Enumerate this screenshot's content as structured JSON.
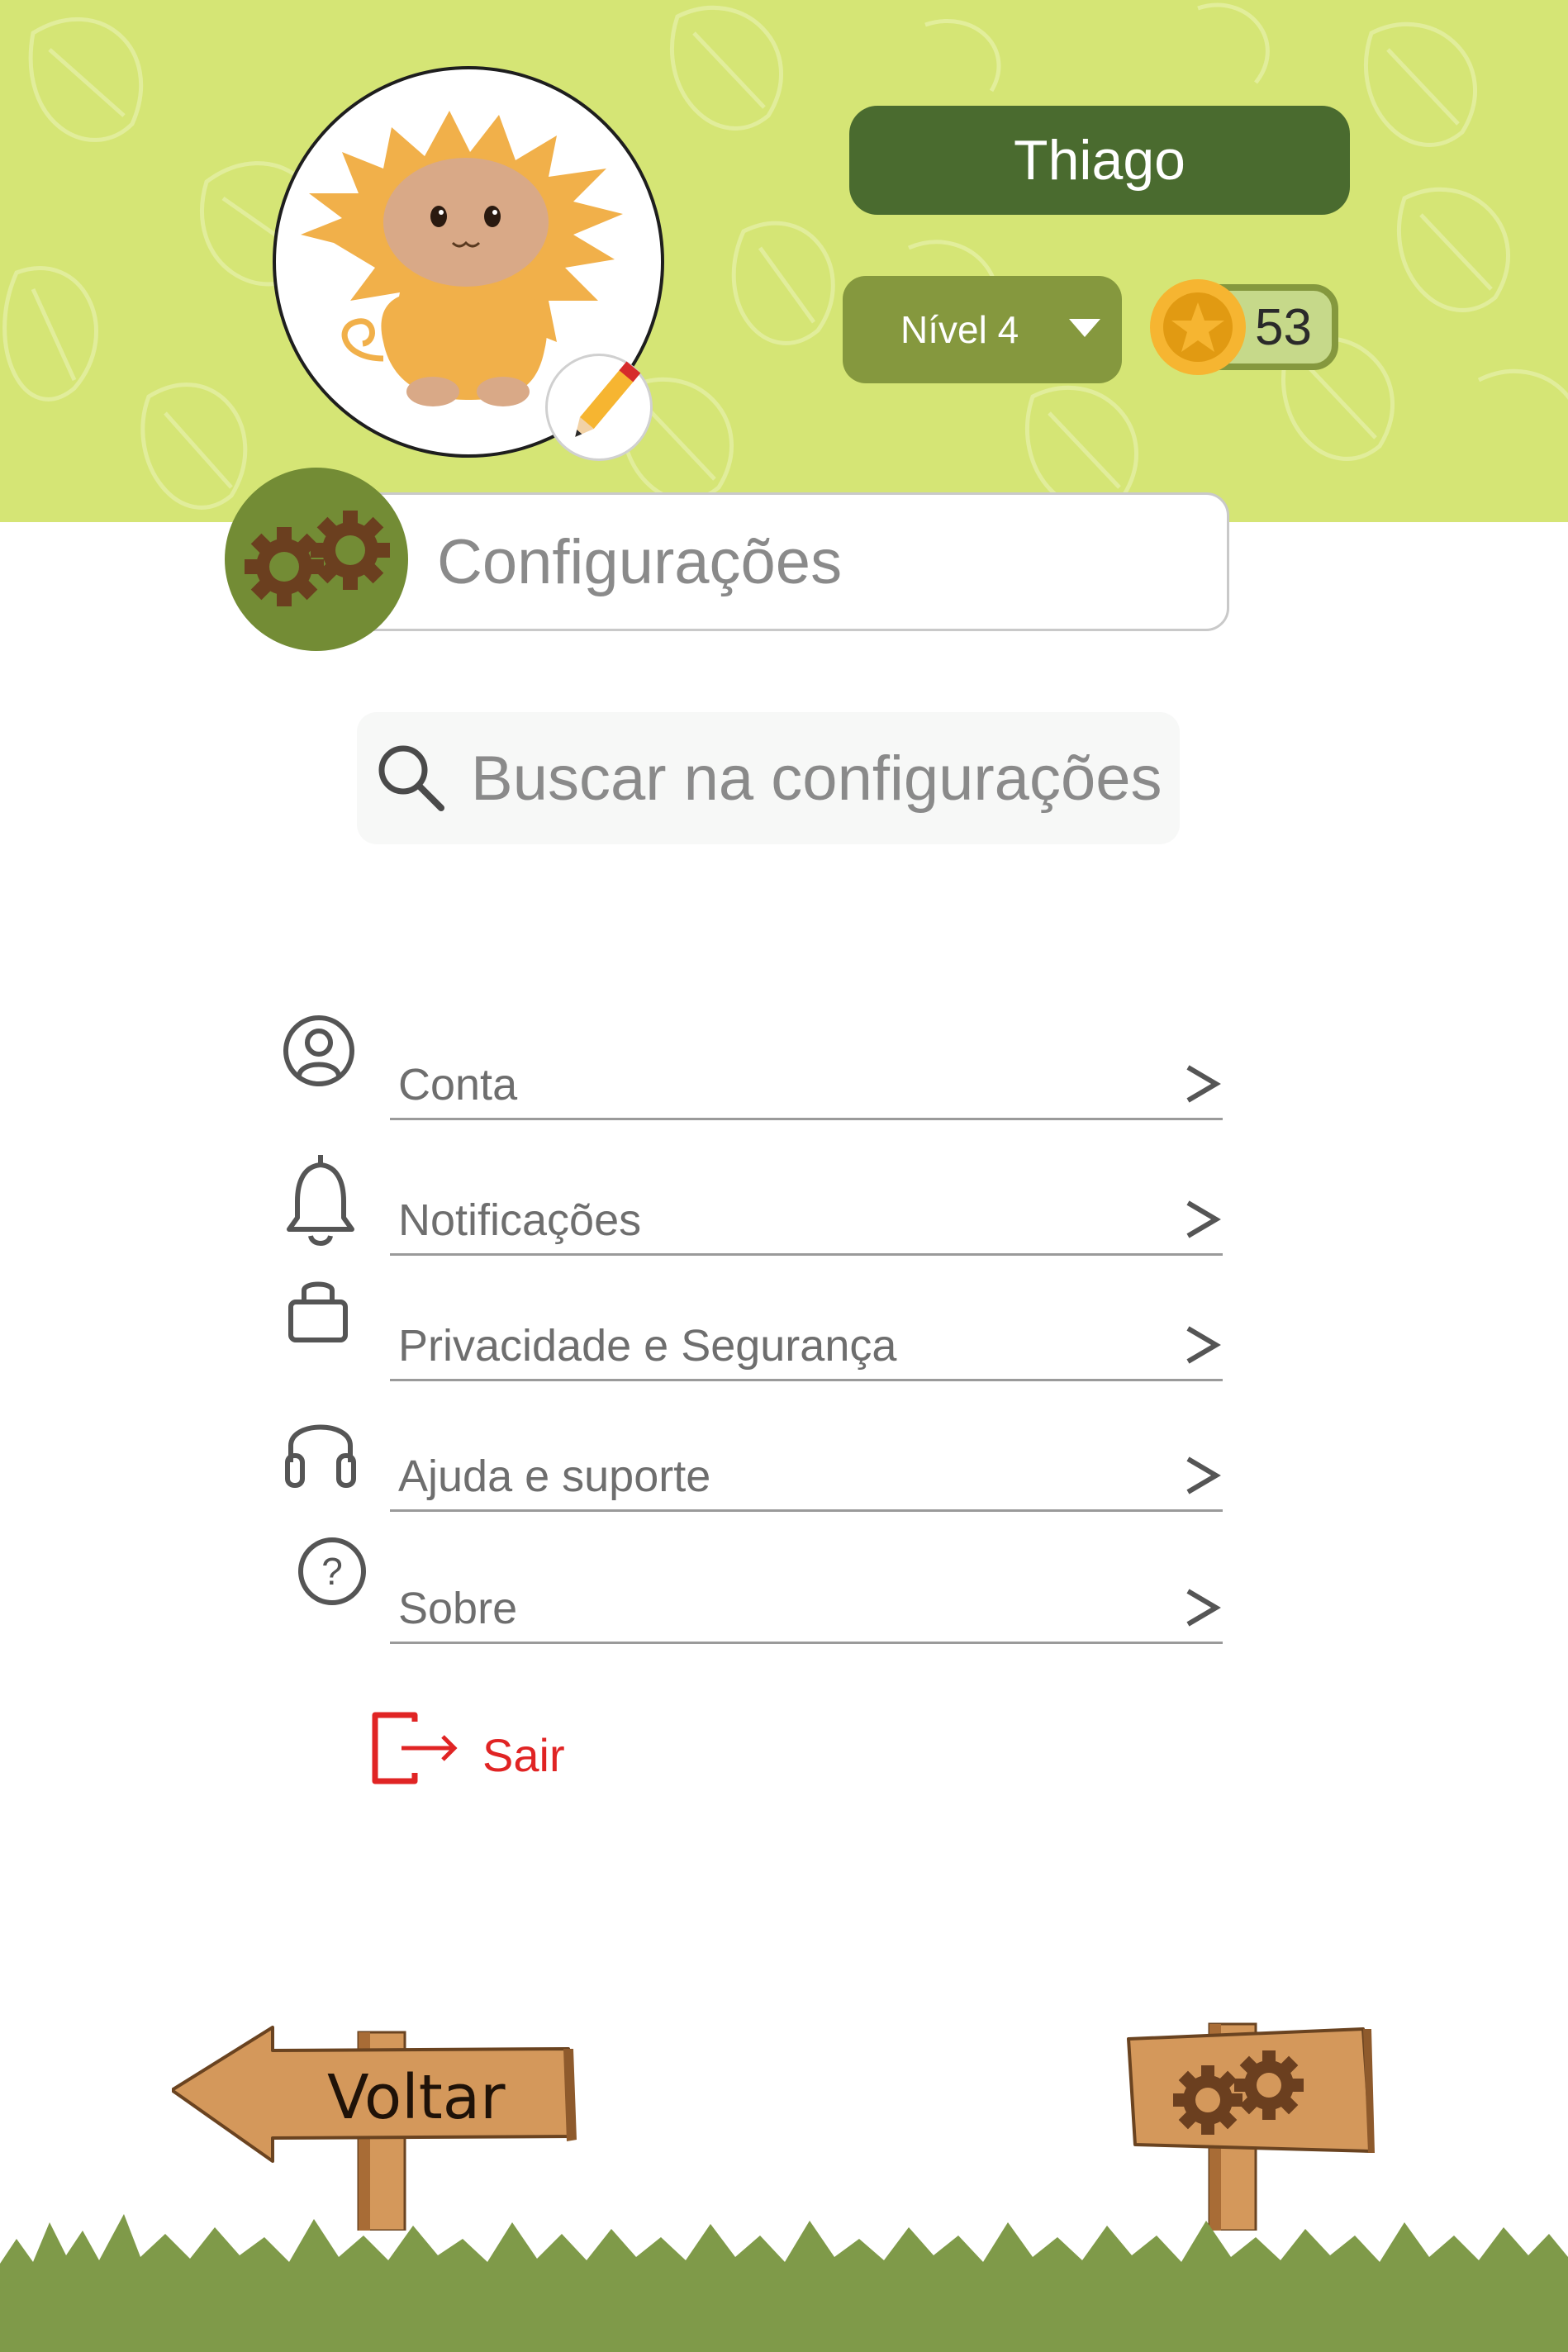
{
  "profile": {
    "name": "Thiago",
    "level": "Nível 4",
    "coins": "53"
  },
  "page": {
    "title": "Configurações"
  },
  "search": {
    "placeholder": "Buscar na configurações"
  },
  "menu": {
    "items": [
      {
        "label": "Conta",
        "icon": "user-circle-icon"
      },
      {
        "label": "Notificações",
        "icon": "bell-icon"
      },
      {
        "label": "Privacidade e Segurança",
        "icon": "lock-icon"
      },
      {
        "label": "Ajuda e suporte",
        "icon": "headphones-icon"
      },
      {
        "label": "Sobre",
        "icon": "question-circle-icon"
      }
    ],
    "logout_label": "Sair"
  },
  "footer": {
    "back_label": "Voltar"
  },
  "colors": {
    "header_bg": "#d5e575",
    "dark_green": "#4a6b2f",
    "olive": "#85983e",
    "grass": "#7f9a49",
    "logout_red": "#e02424",
    "wood": "#d4985b"
  }
}
